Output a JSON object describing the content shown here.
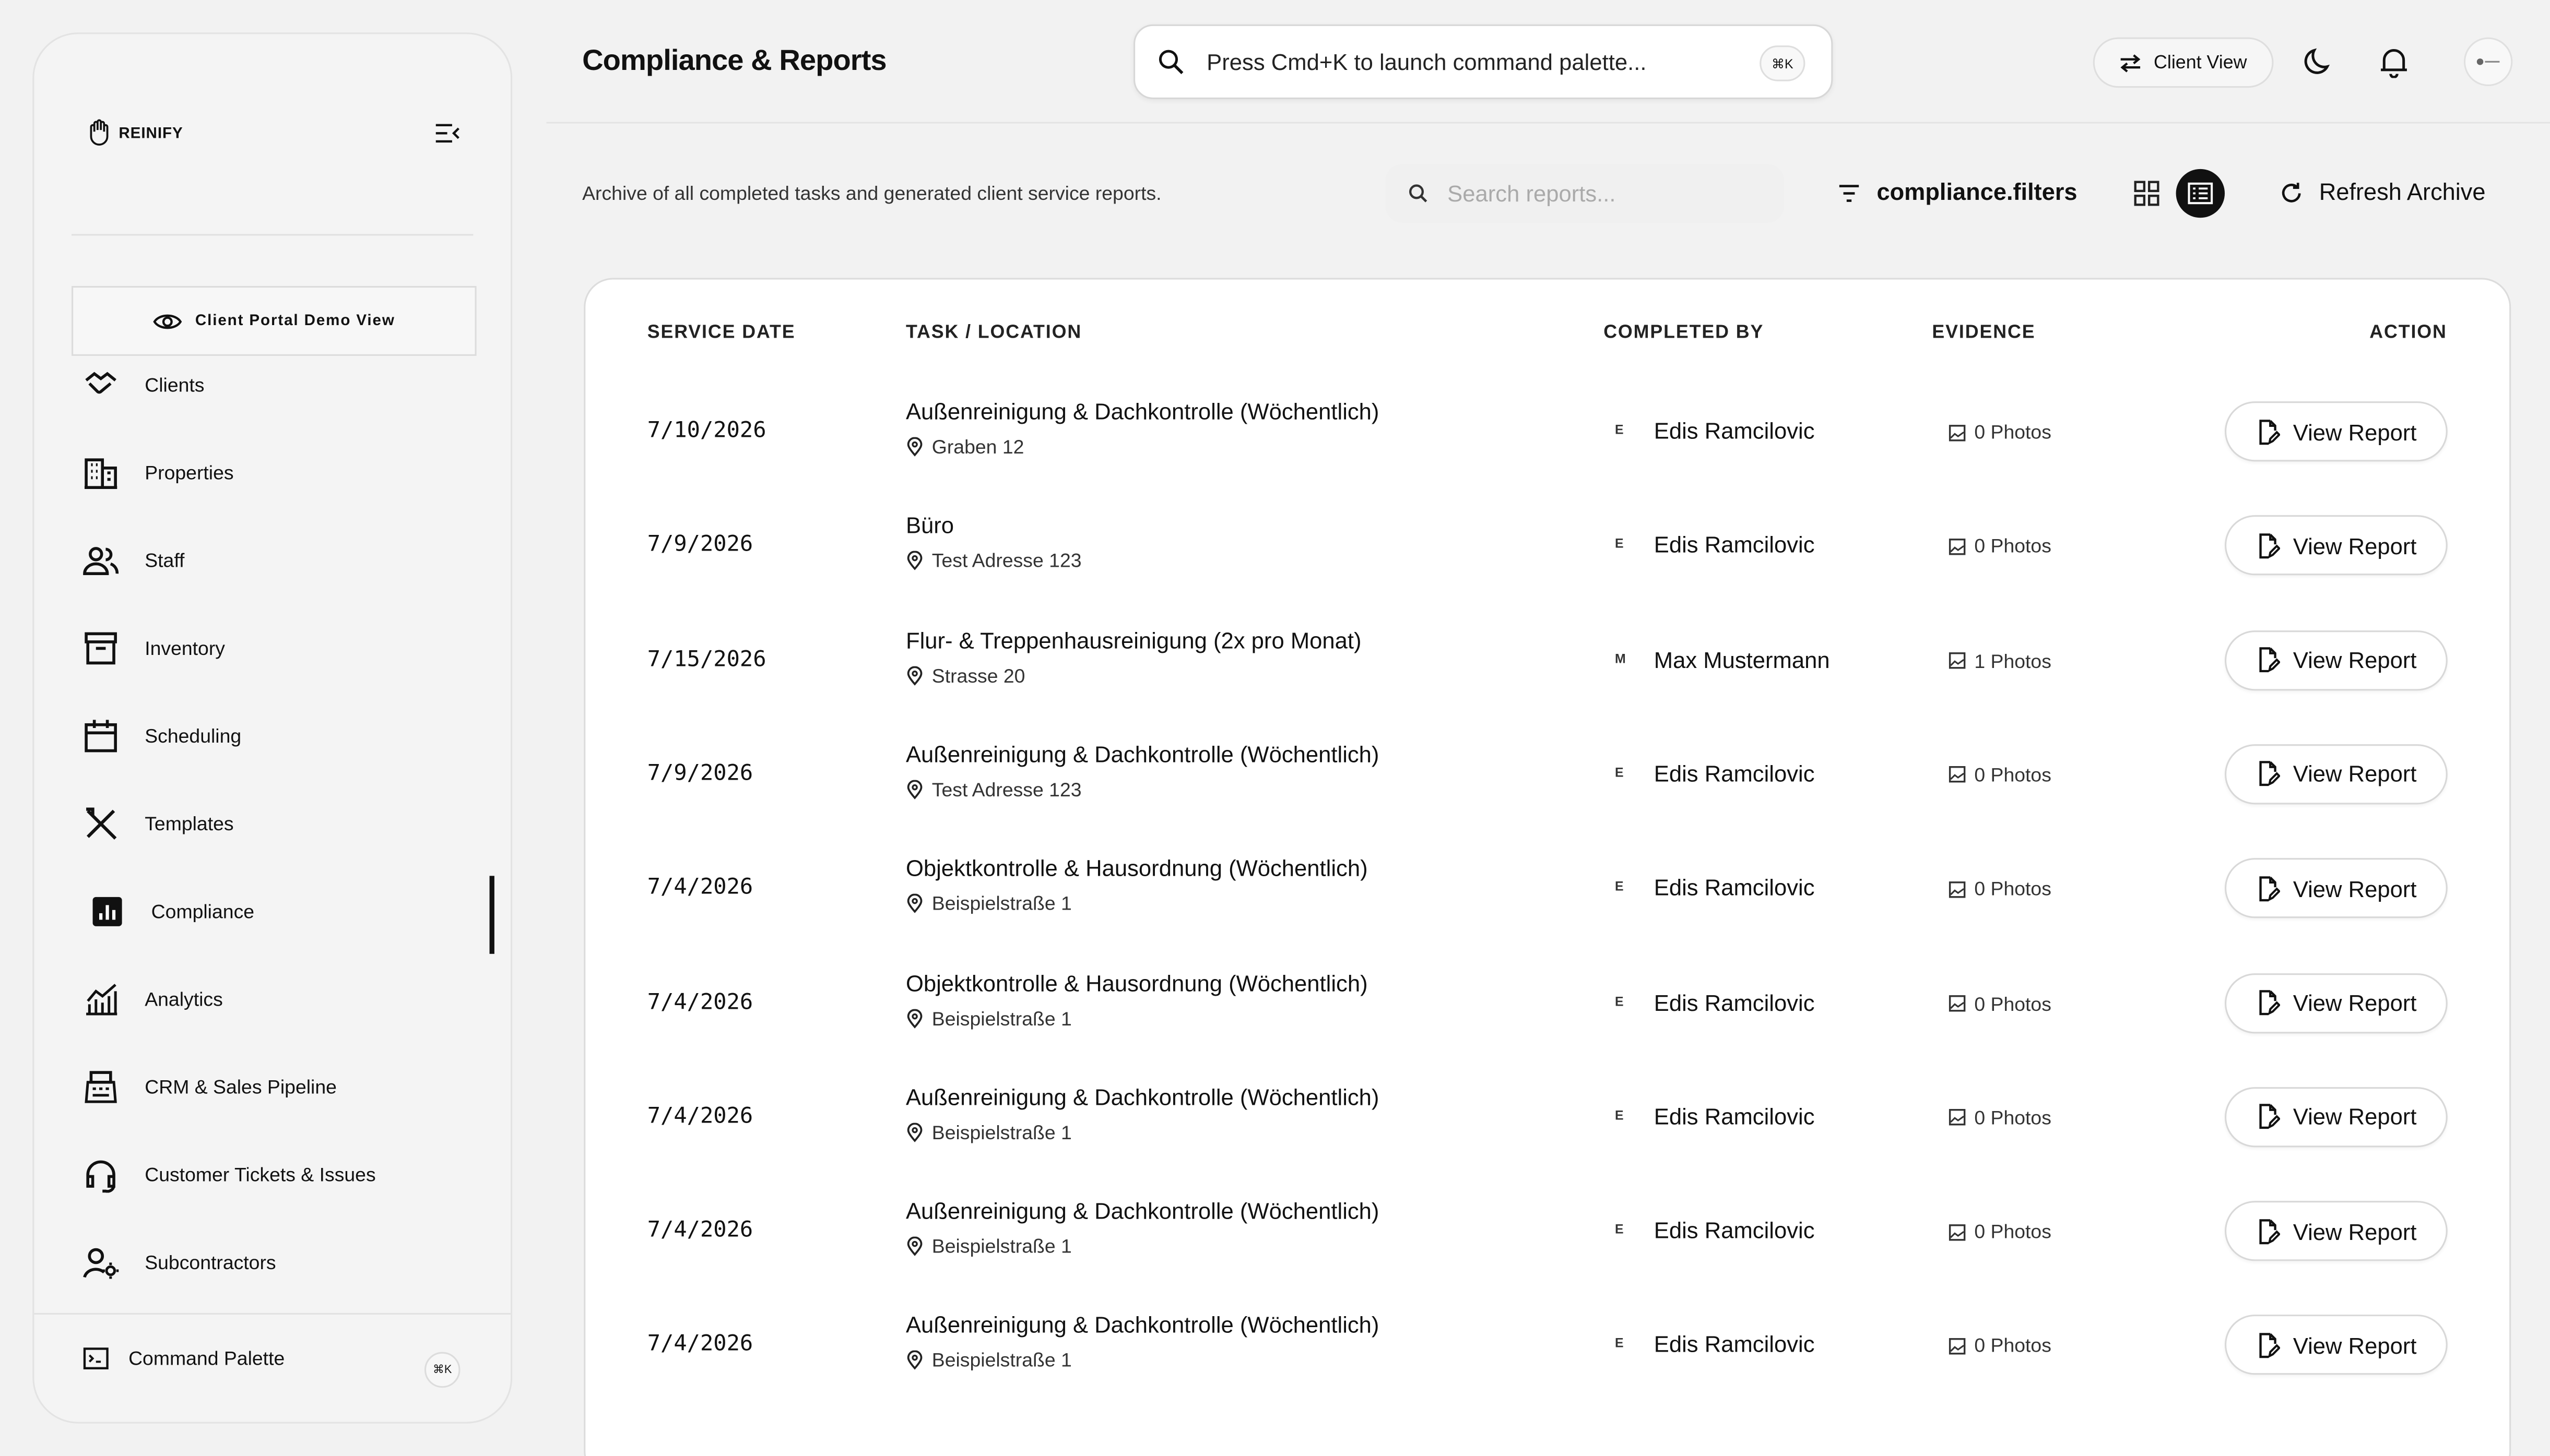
{
  "app": {
    "brand": "REINIFY",
    "page_title": "Compliance & Reports",
    "portal_button": "Client Portal Demo View"
  },
  "topbar": {
    "command_placeholder": "Press Cmd+K to launch command palette...",
    "command_shortcut": "⌘K",
    "client_view_label": "Client View"
  },
  "sidebar": {
    "items": [
      {
        "label": "Clients",
        "icon": "handshake-icon"
      },
      {
        "label": "Properties",
        "icon": "building-icon"
      },
      {
        "label": "Staff",
        "icon": "users-icon"
      },
      {
        "label": "Inventory",
        "icon": "archive-icon"
      },
      {
        "label": "Scheduling",
        "icon": "calendar-icon"
      },
      {
        "label": "Templates",
        "icon": "tools-icon"
      },
      {
        "label": "Compliance",
        "icon": "chart-square-icon",
        "active": true
      },
      {
        "label": "Analytics",
        "icon": "analytics-icon"
      },
      {
        "label": "CRM & Sales Pipeline",
        "icon": "register-icon"
      },
      {
        "label": "Customer Tickets & Issues",
        "icon": "headset-icon"
      },
      {
        "label": "Subcontractors",
        "icon": "user-gear-icon"
      }
    ],
    "command_palette_label": "Command Palette",
    "command_palette_shortcut": "⌘K"
  },
  "toolbar": {
    "description": "Archive of all completed tasks and generated client service reports.",
    "search_placeholder": "Search reports...",
    "filters_label": "compliance.filters",
    "refresh_label": "Refresh Archive"
  },
  "table": {
    "headers": [
      "SERVICE DATE",
      "TASK / LOCATION",
      "COMPLETED BY",
      "EVIDENCE",
      "ACTION"
    ],
    "action_label": "View Report",
    "rows": [
      {
        "date": "7/10/2026",
        "task": "Außenreinigung & Dachkontrolle (Wöchentlich)",
        "location": "Graben 12",
        "initial": "E",
        "person": "Edis Ramcilovic",
        "evidence": "0 Photos"
      },
      {
        "date": "7/9/2026",
        "task": "Büro",
        "location": "Test Adresse 123",
        "initial": "E",
        "person": "Edis Ramcilovic",
        "evidence": "0 Photos"
      },
      {
        "date": "7/15/2026",
        "task": "Flur- & Treppenhausreinigung (2x pro Monat)",
        "location": "Strasse 20",
        "initial": "M",
        "person": "Max Mustermann",
        "evidence": "1 Photos"
      },
      {
        "date": "7/9/2026",
        "task": "Außenreinigung & Dachkontrolle (Wöchentlich)",
        "location": "Test Adresse 123",
        "initial": "E",
        "person": "Edis Ramcilovic",
        "evidence": "0 Photos"
      },
      {
        "date": "7/4/2026",
        "task": "Objektkontrolle & Hausordnung (Wöchentlich)",
        "location": "Beispielstraße 1",
        "initial": "E",
        "person": "Edis Ramcilovic",
        "evidence": "0 Photos"
      },
      {
        "date": "7/4/2026",
        "task": "Objektkontrolle & Hausordnung (Wöchentlich)",
        "location": "Beispielstraße 1",
        "initial": "E",
        "person": "Edis Ramcilovic",
        "evidence": "0 Photos"
      },
      {
        "date": "7/4/2026",
        "task": "Außenreinigung & Dachkontrolle (Wöchentlich)",
        "location": "Beispielstraße 1",
        "initial": "E",
        "person": "Edis Ramcilovic",
        "evidence": "0 Photos"
      },
      {
        "date": "7/4/2026",
        "task": "Außenreinigung & Dachkontrolle (Wöchentlich)",
        "location": "Beispielstraße 1",
        "initial": "E",
        "person": "Edis Ramcilovic",
        "evidence": "0 Photos"
      },
      {
        "date": "7/4/2026",
        "task": "Außenreinigung & Dachkontrolle (Wöchentlich)",
        "location": "Beispielstraße 1",
        "initial": "E",
        "person": "Edis Ramcilovic",
        "evidence": "0 Photos"
      }
    ]
  },
  "colors": {
    "background": "#f2f2f2",
    "accent": "#111111",
    "card": "#ffffff"
  }
}
